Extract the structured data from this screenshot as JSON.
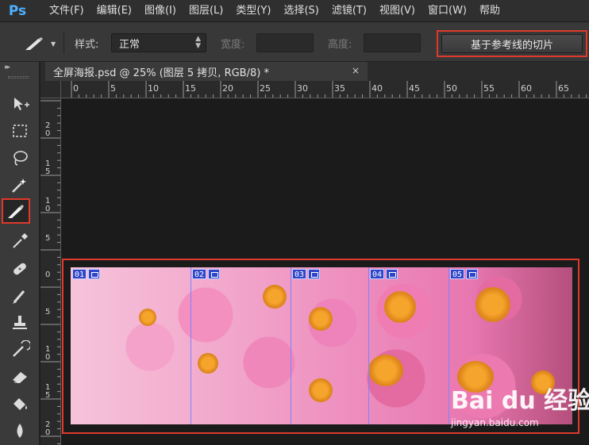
{
  "app": {
    "logo": "Ps"
  },
  "menu": [
    {
      "label": "文件(F)"
    },
    {
      "label": "编辑(E)"
    },
    {
      "label": "图像(I)"
    },
    {
      "label": "图层(L)"
    },
    {
      "label": "类型(Y)"
    },
    {
      "label": "选择(S)"
    },
    {
      "label": "滤镜(T)"
    },
    {
      "label": "视图(V)"
    },
    {
      "label": "窗口(W)"
    },
    {
      "label": "帮助"
    }
  ],
  "options": {
    "style_label": "样式:",
    "style_value": "正常",
    "width_label": "宽度:",
    "height_label": "高度:",
    "slice_button": "基于参考线的切片"
  },
  "document": {
    "tab_title": "全屏海报.psd @ 25% (图层 5 拷贝, RGB/8) *",
    "close": "×"
  },
  "ruler_top": [
    "0",
    "5",
    "10",
    "15",
    "20",
    "25",
    "30",
    "35",
    "40",
    "45",
    "50",
    "55",
    "60",
    "65"
  ],
  "ruler_left": [
    "2 0",
    "1 5",
    "1 0",
    "5",
    "0",
    "5",
    "1 0",
    "1 5",
    "2 0"
  ],
  "slices": [
    {
      "num": "01"
    },
    {
      "num": "02"
    },
    {
      "num": "03"
    },
    {
      "num": "04"
    },
    {
      "num": "05"
    }
  ],
  "watermark": {
    "brand": "Bai du 经验",
    "url": "jingyan.baidu.com"
  },
  "colors": {
    "highlight": "#e0392b",
    "slice_blue": "#3046c9",
    "ps_blue": "#4fb0ff"
  },
  "icons": {
    "tools": [
      "move-tool-icon",
      "marquee-tool-icon",
      "lasso-tool-icon",
      "magic-wand-tool-icon",
      "slice-tool-icon",
      "eyedropper-tool-icon",
      "healing-brush-tool-icon",
      "brush-tool-icon",
      "stamp-tool-icon",
      "history-brush-tool-icon",
      "eraser-tool-icon",
      "paint-bucket-tool-icon",
      "blur-tool-icon"
    ]
  }
}
